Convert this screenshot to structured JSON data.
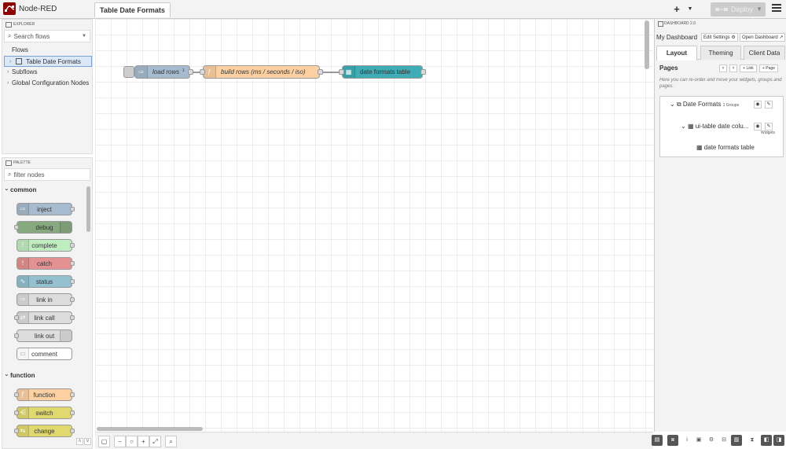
{
  "header": {
    "app_title": "Node-RED",
    "active_tab": "Table Date Formats",
    "add_icon": "plus-icon",
    "deploy_label": "Deploy",
    "menu_icon": "hamburger-icon"
  },
  "explorer": {
    "title": "EXPLORER",
    "search_placeholder": "Search flows",
    "flows_label": "Flows",
    "flow_items": [
      "Table Date Formats"
    ],
    "subflows_label": "Subflows",
    "global_config_label": "Global Configuration Nodes"
  },
  "palette": {
    "title": "PALETTE",
    "filter_placeholder": "filter nodes",
    "categories": [
      {
        "name": "common",
        "nodes": [
          {
            "label": "inject",
            "color": "#a6bbcf"
          },
          {
            "label": "debug",
            "color": "#87a980"
          },
          {
            "label": "complete",
            "color": "#c0edc0"
          },
          {
            "label": "catch",
            "color": "#e49191"
          },
          {
            "label": "status",
            "color": "#94c1d0"
          },
          {
            "label": "link in",
            "color": "#dddddd"
          },
          {
            "label": "link call",
            "color": "#dddddd"
          },
          {
            "label": "link out",
            "color": "#dddddd"
          },
          {
            "label": "comment",
            "color": "#ffffff"
          }
        ]
      },
      {
        "name": "function",
        "nodes": [
          {
            "label": "function",
            "color": "#fdd0a2"
          },
          {
            "label": "switch",
            "color": "#e2d96e"
          },
          {
            "label": "change",
            "color": "#e2d96e"
          }
        ]
      }
    ]
  },
  "flow_nodes": [
    {
      "label": "load rows",
      "badge": "1",
      "color": "#a6bbcf"
    },
    {
      "label": "build rows (ms / seconds / iso)",
      "color": "#fdd0a2"
    },
    {
      "label": "date formats table",
      "color": "#3fadb5"
    }
  ],
  "sidebar": {
    "title": "DASHBOARD 2.0",
    "dashboard_name": "My Dashboard",
    "edit_settings": "Edit Settings",
    "open_dashboard": "Open Dashboard",
    "tabs": [
      "Layout",
      "Theming",
      "Client Data"
    ],
    "pages_title": "Pages",
    "add_link": "+ Link",
    "add_page": "+ Page",
    "pages_help": "Here you can re-order and move your widgets, groups and pages.",
    "page_name": "Date Formats",
    "page_groups": "1 Groups",
    "group_name": "ui-table date colu...",
    "group_tooltip": "Widgets",
    "widget_name": "date formats table"
  },
  "colors": {
    "logo": "#8f0000",
    "active_sidebar_btn": "#555555"
  }
}
